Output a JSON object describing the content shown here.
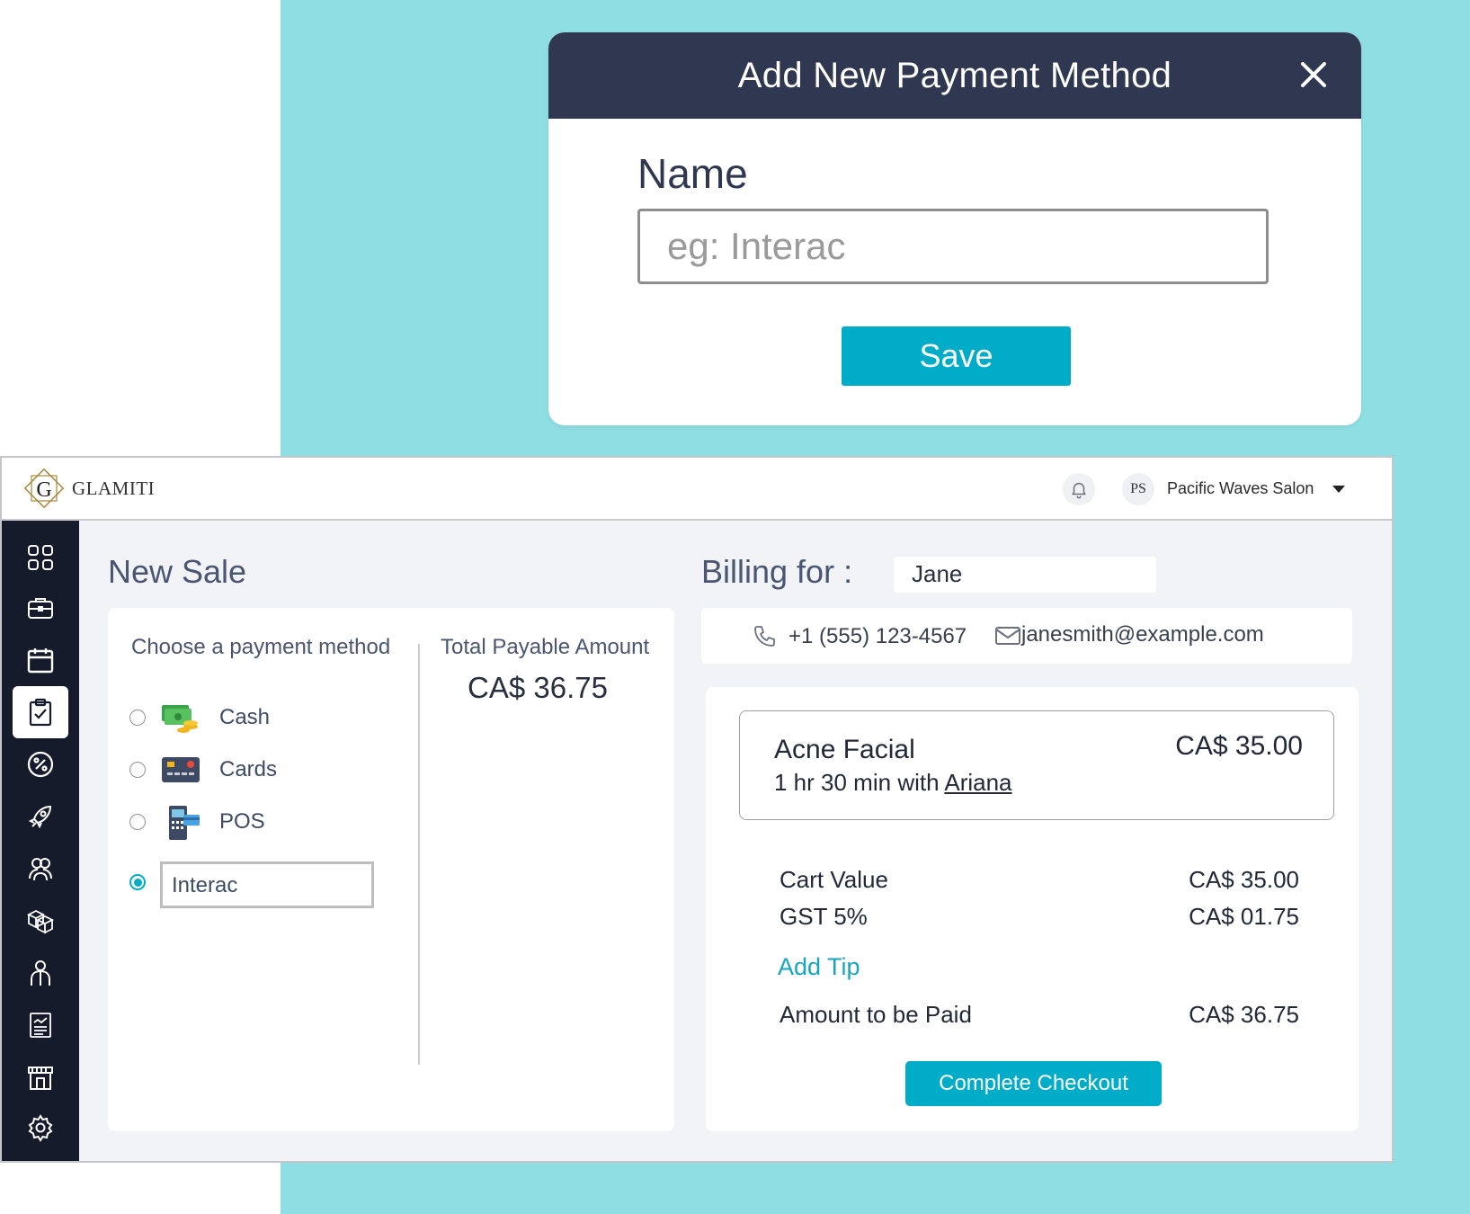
{
  "colors": {
    "teal_bg": "#8fdee3",
    "modal_header": "#2f3850",
    "accent": "#00acc7",
    "sidebar": "#161b2b"
  },
  "modal": {
    "title": "Add New Payment Method",
    "close_icon": "close-icon",
    "name_label": "Name",
    "name_placeholder": "eg: Interac",
    "name_value": "",
    "save_label": "Save"
  },
  "topbar": {
    "brand": "GLAMITI",
    "avatar_initials": "PS",
    "salon_name": "Pacific Waves Salon"
  },
  "sidebar": {
    "items": [
      {
        "icon": "dashboard-grid-icon"
      },
      {
        "icon": "briefcase-icon"
      },
      {
        "icon": "calendar-icon"
      },
      {
        "icon": "clipboard-check-icon",
        "active": true
      },
      {
        "icon": "discount-badge-icon"
      },
      {
        "icon": "rocket-icon"
      },
      {
        "icon": "clients-group-icon"
      },
      {
        "icon": "inventory-boxes-icon"
      },
      {
        "icon": "staff-person-icon"
      },
      {
        "icon": "reports-icon"
      },
      {
        "icon": "store-icon"
      },
      {
        "icon": "settings-gear-icon"
      }
    ]
  },
  "sale": {
    "title": "New Sale",
    "payment_heading": "Choose a payment method",
    "total_heading": "Total Payable Amount",
    "total_value": "CA$ 36.75",
    "methods": [
      {
        "label": "Cash",
        "icon": "cash-icon",
        "selected": false
      },
      {
        "label": "Cards",
        "icon": "card-icon",
        "selected": false
      },
      {
        "label": "POS",
        "icon": "pos-terminal-icon",
        "selected": false
      },
      {
        "label": "Interac",
        "icon": "",
        "selected": true
      }
    ]
  },
  "billing": {
    "label": "Billing for :",
    "client": "Jane",
    "phone": "+1 (555) 123-4567",
    "email": "janesmith@example.com",
    "service": {
      "name": "Acne Facial",
      "price": "CA$ 35.00",
      "duration": "1 hr 30 min",
      "with": "with",
      "stylist": "Ariana"
    },
    "lines": [
      {
        "label": "Cart Value",
        "value": "CA$ 35.00"
      },
      {
        "label": "GST 5%",
        "value": "CA$ 01.75"
      }
    ],
    "add_tip": "Add Tip",
    "amount_label": "Amount to be Paid",
    "amount_value": "CA$ 36.75",
    "checkout_label": "Complete Checkout"
  }
}
